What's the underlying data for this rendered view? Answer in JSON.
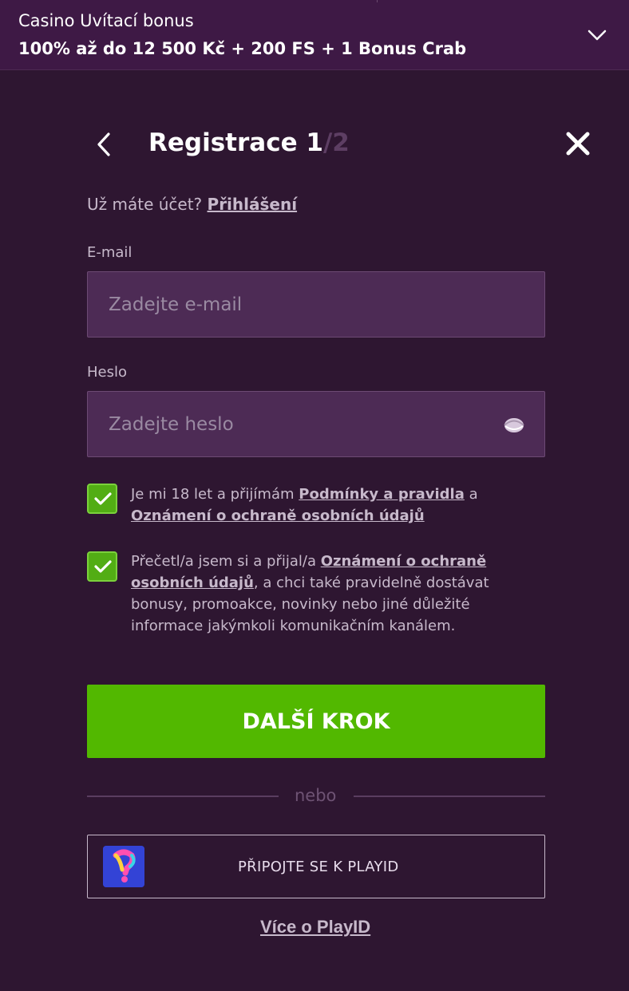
{
  "banner": {
    "title": "Casino Uvítací bonus",
    "offer": "100% až do 12 500 Kč + 200 FS + 1 Bonus Crab"
  },
  "header": {
    "title_main": "Registrace 1",
    "title_slash": "/2"
  },
  "login": {
    "prompt": "Už máte účet?",
    "link": "Přihlášení"
  },
  "email": {
    "label": "E-mail",
    "placeholder": "Zadejte e-mail",
    "value": ""
  },
  "password": {
    "label": "Heslo",
    "placeholder": "Zadejte heslo",
    "value": ""
  },
  "consent1": {
    "checked": true,
    "text_before": "Je mi 18 let a přijímám",
    "link1": "Podmínky a pravidla",
    "text_mid": "a",
    "link2": "Oznámení o ochraně osobních údajů"
  },
  "consent2": {
    "checked": true,
    "text_before": "Přečetl/a jsem si a přijal/a",
    "link": "Oznámení o ochraně osobních údajů",
    "text_after": ", a chci také pravidelně dostávat bonusy, promoakce, novinky nebo jiné důležité informace jakýmkoli komunikačním kanálem."
  },
  "next_button": "DALŠÍ KROK",
  "divider": "nebo",
  "playid": {
    "button_label": "PŘIPOJTE SE K PLAYID",
    "more_link": "Více o PlayID"
  },
  "colors": {
    "background": "#2e1631",
    "banner": "#3e1945",
    "field": "#4d2b55",
    "primary_green": "#52b800",
    "muted_text": "#c7b9cb"
  },
  "icons": {
    "banner_toggle": "chevron-down-icon",
    "back": "chevron-left-icon",
    "close": "close-icon",
    "password_toggle": "eye-icon",
    "checkbox": "checkmark-icon",
    "playid": "playid-logo-icon"
  }
}
